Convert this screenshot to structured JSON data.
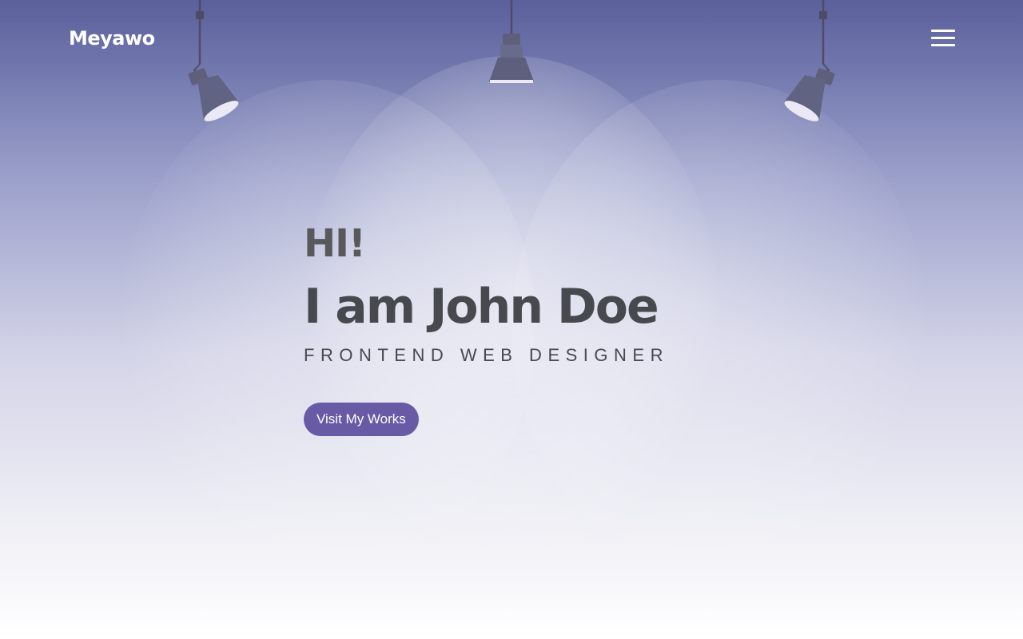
{
  "header": {
    "brand": "Meyawo",
    "menu_icon": "hamburger-menu-icon"
  },
  "hero": {
    "greeting": "HI!",
    "headline": "I am John Doe",
    "subtitle": "FRONTEND WEB DESIGNER",
    "cta_label": "Visit My Works",
    "decor_icons": [
      "spotlight-lamp-icon",
      "spotlight-lamp-icon",
      "spotlight-lamp-icon"
    ]
  },
  "colors": {
    "accent": "#695aa6",
    "heading_text": "#46494e",
    "header_text": "#ffffff",
    "background_top": "#5b5f9b",
    "background_bottom": "#ffffff"
  }
}
